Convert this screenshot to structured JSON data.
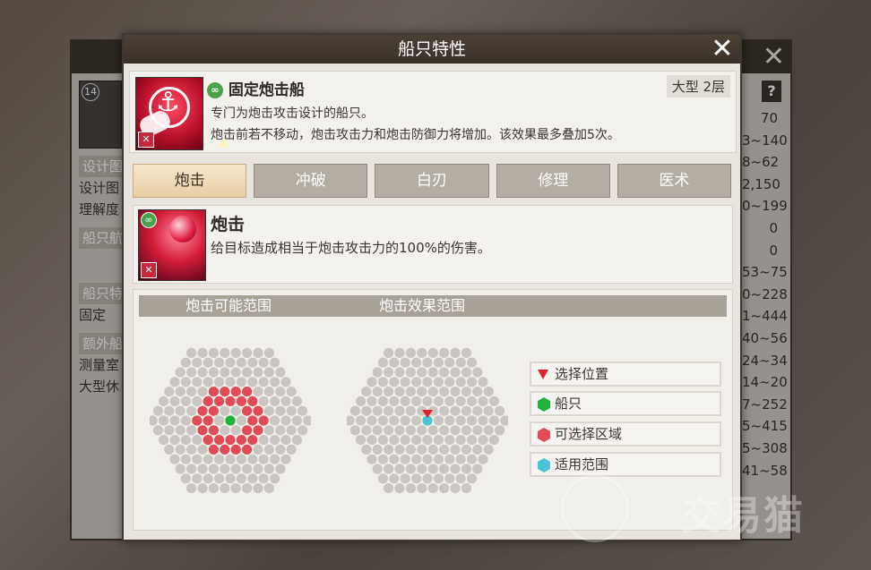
{
  "dialog": {
    "title": "船只特性",
    "close_glyph": "✕"
  },
  "ship": {
    "name": "固定炮击船",
    "size": "大型 2层",
    "desc1": "专门为炮击攻击设计的船只。",
    "desc2": "炮击前若不移动，炮击攻击力和炮击防御力将增加。该效果最多叠加5次。"
  },
  "tabs": [
    {
      "label": "炮击",
      "active": true
    },
    {
      "label": "冲破",
      "active": false
    },
    {
      "label": "白刃",
      "active": false
    },
    {
      "label": "修理",
      "active": false
    },
    {
      "label": "医术",
      "active": false
    }
  ],
  "skill": {
    "name": "炮击",
    "desc": "给目标造成相当于炮击攻击力的100%的伤害。"
  },
  "range": {
    "possible_label": "炮击可能范围",
    "effect_label": "炮击效果范围"
  },
  "legend": [
    {
      "label": "选择位置",
      "icon": "red-triangle",
      "color": "#e0202a"
    },
    {
      "label": "船只",
      "icon": "green-hexagon",
      "color": "#1fb53a"
    },
    {
      "label": "可选择区域",
      "icon": "red-hexagon",
      "color": "#e14b55"
    },
    {
      "label": "适用范围",
      "icon": "cyan-hexagon",
      "color": "#4bc4d6"
    }
  ],
  "background_panel": {
    "level": "14",
    "left_rows": [
      "设计图",
      "设计图",
      "理解度",
      "船只航",
      "船只特",
      "固定",
      "额外船",
      "测量室",
      "大型休"
    ],
    "values": [
      "70",
      "3~140",
      "8~62",
      "2,150",
      "0~199",
      "0",
      "0",
      "53~75",
      "0~228",
      "1~444",
      "40~56",
      "24~34",
      "14~20",
      "7~252",
      "5~415",
      "5~308",
      "41~58"
    ],
    "help": "?"
  },
  "watermark": "交易猫",
  "colors": {
    "grid": "#c9c6c1",
    "range": "#e14b55",
    "ship": "#1fb53a",
    "apply": "#4bc4d6",
    "select": "#e0202a"
  }
}
